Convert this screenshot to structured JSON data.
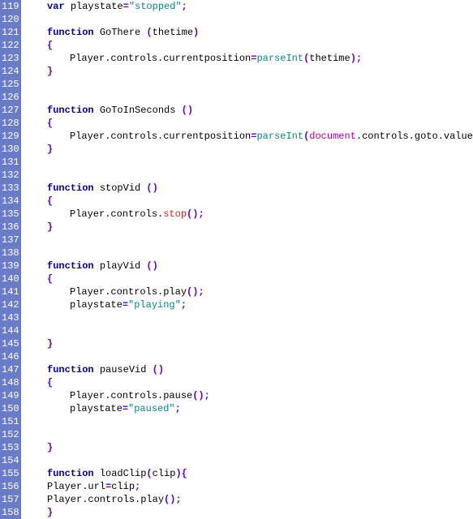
{
  "lines": [
    {
      "n": "119",
      "indent": 1,
      "tokens": [
        {
          "t": "var ",
          "c": "kw"
        },
        {
          "t": "playstate",
          "c": "id"
        },
        {
          "t": "=",
          "c": "pun"
        },
        {
          "t": "\"stopped\"",
          "c": "str"
        },
        {
          "t": ";",
          "c": "pun"
        }
      ]
    },
    {
      "n": "120",
      "indent": 0,
      "tokens": []
    },
    {
      "n": "121",
      "indent": 1,
      "tokens": [
        {
          "t": "function ",
          "c": "kw"
        },
        {
          "t": "GoThere ",
          "c": "id"
        },
        {
          "t": "(",
          "c": "pun"
        },
        {
          "t": "thetime",
          "c": "id"
        },
        {
          "t": ")",
          "c": "pun"
        }
      ]
    },
    {
      "n": "122",
      "indent": 1,
      "tokens": [
        {
          "t": "{",
          "c": "pun"
        }
      ]
    },
    {
      "n": "123",
      "indent": 2,
      "tokens": [
        {
          "t": "Player.controls.currentposition",
          "c": "id"
        },
        {
          "t": "=",
          "c": "pun"
        },
        {
          "t": "parseInt",
          "c": "fn"
        },
        {
          "t": "(",
          "c": "pun"
        },
        {
          "t": "thetime",
          "c": "id"
        },
        {
          "t": ")",
          "c": "pun"
        },
        {
          "t": ";",
          "c": "pun"
        }
      ]
    },
    {
      "n": "124",
      "indent": 1,
      "tokens": [
        {
          "t": "}",
          "c": "pun"
        }
      ]
    },
    {
      "n": "125",
      "indent": 0,
      "tokens": []
    },
    {
      "n": "126",
      "indent": 0,
      "tokens": []
    },
    {
      "n": "127",
      "indent": 1,
      "tokens": [
        {
          "t": "function ",
          "c": "kw"
        },
        {
          "t": "GoToInSeconds ",
          "c": "id"
        },
        {
          "t": "()",
          "c": "pun"
        }
      ]
    },
    {
      "n": "128",
      "indent": 1,
      "tokens": [
        {
          "t": "{",
          "c": "pun"
        }
      ]
    },
    {
      "n": "129",
      "indent": 2,
      "tokens": [
        {
          "t": "Player.controls.currentposition",
          "c": "id"
        },
        {
          "t": "=",
          "c": "pun"
        },
        {
          "t": "parseInt",
          "c": "fn"
        },
        {
          "t": "(",
          "c": "pun"
        },
        {
          "t": "document",
          "c": "obj"
        },
        {
          "t": ".controls.goto.value",
          "c": "id"
        },
        {
          "t": ")",
          "c": "pun"
        },
        {
          "t": ";",
          "c": "pun"
        }
      ]
    },
    {
      "n": "130",
      "indent": 1,
      "tokens": [
        {
          "t": "}",
          "c": "pun"
        }
      ]
    },
    {
      "n": "131",
      "indent": 0,
      "tokens": []
    },
    {
      "n": "132",
      "indent": 0,
      "tokens": []
    },
    {
      "n": "133",
      "indent": 1,
      "tokens": [
        {
          "t": "function ",
          "c": "kw"
        },
        {
          "t": "stopVid ",
          "c": "id"
        },
        {
          "t": "()",
          "c": "pun"
        }
      ]
    },
    {
      "n": "134",
      "indent": 1,
      "tokens": [
        {
          "t": "{",
          "c": "pun"
        }
      ]
    },
    {
      "n": "135",
      "indent": 2,
      "tokens": [
        {
          "t": "Player.controls.",
          "c": "id"
        },
        {
          "t": "stop",
          "c": "meth"
        },
        {
          "t": "()",
          "c": "pun"
        },
        {
          "t": ";",
          "c": "pun"
        }
      ]
    },
    {
      "n": "136",
      "indent": 1,
      "tokens": [
        {
          "t": "}",
          "c": "pun"
        }
      ]
    },
    {
      "n": "137",
      "indent": 0,
      "tokens": []
    },
    {
      "n": "138",
      "indent": 0,
      "tokens": []
    },
    {
      "n": "139",
      "indent": 1,
      "tokens": [
        {
          "t": "function ",
          "c": "kw"
        },
        {
          "t": "playVid ",
          "c": "id"
        },
        {
          "t": "()",
          "c": "pun"
        }
      ]
    },
    {
      "n": "140",
      "indent": 1,
      "tokens": [
        {
          "t": "{",
          "c": "pun"
        }
      ]
    },
    {
      "n": "141",
      "indent": 2,
      "tokens": [
        {
          "t": "Player.controls.play",
          "c": "id"
        },
        {
          "t": "()",
          "c": "pun"
        },
        {
          "t": ";",
          "c": "pun"
        }
      ]
    },
    {
      "n": "142",
      "indent": 2,
      "tokens": [
        {
          "t": "playstate",
          "c": "id"
        },
        {
          "t": "=",
          "c": "pun"
        },
        {
          "t": "\"playing\"",
          "c": "str"
        },
        {
          "t": ";",
          "c": "pun"
        }
      ]
    },
    {
      "n": "143",
      "indent": 0,
      "tokens": []
    },
    {
      "n": "144",
      "indent": 0,
      "tokens": []
    },
    {
      "n": "145",
      "indent": 1,
      "tokens": [
        {
          "t": "}",
          "c": "pun"
        }
      ]
    },
    {
      "n": "146",
      "indent": 0,
      "tokens": []
    },
    {
      "n": "147",
      "indent": 1,
      "tokens": [
        {
          "t": "function ",
          "c": "kw"
        },
        {
          "t": "pauseVid ",
          "c": "id"
        },
        {
          "t": "()",
          "c": "pun"
        }
      ]
    },
    {
      "n": "148",
      "indent": 1,
      "tokens": [
        {
          "t": "{",
          "c": "pun"
        }
      ]
    },
    {
      "n": "149",
      "indent": 2,
      "tokens": [
        {
          "t": "Player.controls.pause",
          "c": "id"
        },
        {
          "t": "()",
          "c": "pun"
        },
        {
          "t": ";",
          "c": "pun"
        }
      ]
    },
    {
      "n": "150",
      "indent": 2,
      "tokens": [
        {
          "t": "playstate",
          "c": "id"
        },
        {
          "t": "=",
          "c": "pun"
        },
        {
          "t": "\"paused\"",
          "c": "str"
        },
        {
          "t": ";",
          "c": "pun"
        }
      ]
    },
    {
      "n": "151",
      "indent": 0,
      "tokens": []
    },
    {
      "n": "152",
      "indent": 0,
      "tokens": []
    },
    {
      "n": "153",
      "indent": 1,
      "tokens": [
        {
          "t": "}",
          "c": "pun"
        }
      ]
    },
    {
      "n": "154",
      "indent": 0,
      "tokens": []
    },
    {
      "n": "155",
      "indent": 1,
      "tokens": [
        {
          "t": "function ",
          "c": "kw"
        },
        {
          "t": "loadClip",
          "c": "id"
        },
        {
          "t": "(",
          "c": "pun"
        },
        {
          "t": "clip",
          "c": "id"
        },
        {
          "t": ")",
          "c": "pun"
        },
        {
          "t": "{",
          "c": "pun"
        }
      ]
    },
    {
      "n": "156",
      "indent": 1,
      "tokens": [
        {
          "t": "Player.url",
          "c": "id"
        },
        {
          "t": "=",
          "c": "pun"
        },
        {
          "t": "clip",
          "c": "id"
        },
        {
          "t": ";",
          "c": "pun"
        }
      ]
    },
    {
      "n": "157",
      "indent": 1,
      "tokens": [
        {
          "t": "Player.controls.play",
          "c": "id"
        },
        {
          "t": "()",
          "c": "pun"
        },
        {
          "t": ";",
          "c": "pun"
        }
      ]
    },
    {
      "n": "158",
      "indent": 1,
      "tokens": [
        {
          "t": "}",
          "c": "pun"
        }
      ]
    }
  ]
}
